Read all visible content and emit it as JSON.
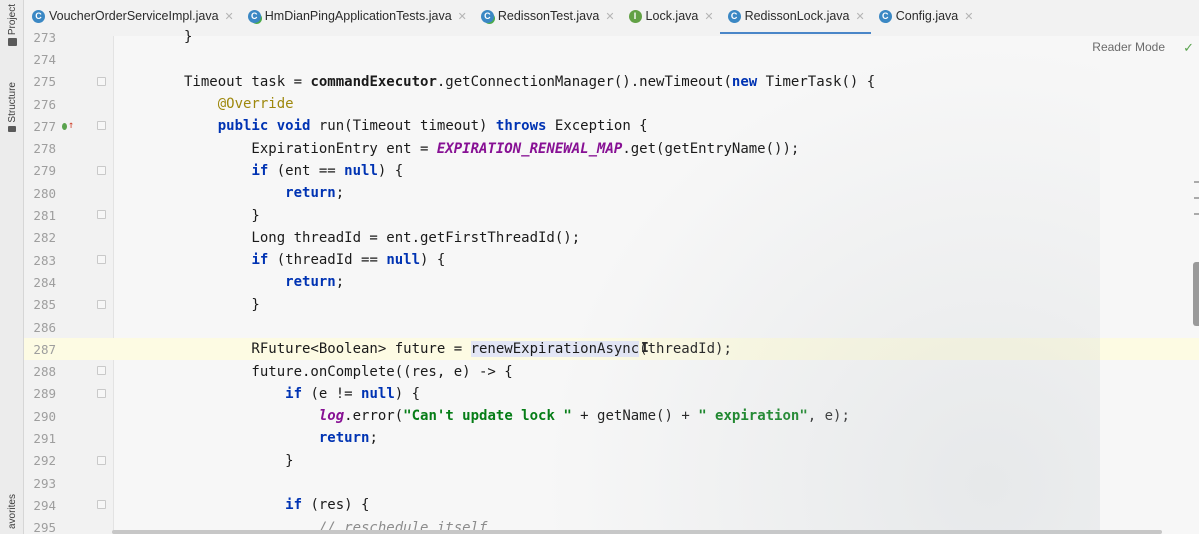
{
  "left_strip": {
    "project_label": "Project",
    "structure_label": "Structure",
    "favorites_label": "avorites"
  },
  "tabs": [
    {
      "name": "VoucherOrderServiceImpl.java",
      "icon": "class-icon",
      "active": false
    },
    {
      "name": "HmDianPingApplicationTests.java",
      "icon": "test-class-icon",
      "active": false
    },
    {
      "name": "RedissonTest.java",
      "icon": "test-class-icon",
      "active": false
    },
    {
      "name": "Lock.java",
      "icon": "interface-icon",
      "active": false
    },
    {
      "name": "RedissonLock.java",
      "icon": "class-icon",
      "active": true
    },
    {
      "name": "Config.java",
      "icon": "class-icon",
      "active": false
    }
  ],
  "tab_close_glyph": "✕",
  "reader_mode_label": "Reader Mode",
  "check_glyph": "✓",
  "colors": {
    "keyword": "#0033b3",
    "method": "#00627a",
    "static_field": "#871094",
    "string": "#067d17",
    "annotation": "#9e880d",
    "current_line": "#fdfbe3",
    "active_tab_underline": "#4a86c8"
  },
  "code": {
    "lines": [
      {
        "number": "273",
        "tokens": [
          {
            "t": "}",
            "c": ""
          }
        ]
      },
      {
        "number": "274",
        "tokens": []
      },
      {
        "number": "275",
        "tokens": [
          {
            "t": "Timeout task = ",
            "c": ""
          },
          {
            "t": "commandExecutor",
            "c": "boldname"
          },
          {
            "t": ".getConnectionManager().newTimeout(",
            "c": ""
          },
          {
            "t": "new",
            "c": "kw"
          },
          {
            "t": " TimerTask() {",
            "c": ""
          }
        ]
      },
      {
        "number": "276",
        "tokens": [
          {
            "t": "    @Override",
            "c": "anno"
          }
        ]
      },
      {
        "number": "277",
        "gutter_icon": "override-up-icon",
        "tokens": [
          {
            "t": "    ",
            "c": ""
          },
          {
            "t": "public",
            "c": "kw"
          },
          {
            "t": " ",
            "c": ""
          },
          {
            "t": "void",
            "c": "kw"
          },
          {
            "t": " run(Timeout timeout) ",
            "c": ""
          },
          {
            "t": "throws",
            "c": "kw"
          },
          {
            "t": " Exception {",
            "c": ""
          }
        ]
      },
      {
        "number": "278",
        "tokens": [
          {
            "t": "        ExpirationEntry ent = ",
            "c": ""
          },
          {
            "t": "EXPIRATION_RENEWAL_MAP",
            "c": "italic-field"
          },
          {
            "t": ".get(getEntryName());",
            "c": ""
          }
        ]
      },
      {
        "number": "279",
        "tokens": [
          {
            "t": "        ",
            "c": ""
          },
          {
            "t": "if",
            "c": "kw"
          },
          {
            "t": " (ent == ",
            "c": ""
          },
          {
            "t": "null",
            "c": "kw"
          },
          {
            "t": ") {",
            "c": ""
          }
        ]
      },
      {
        "number": "280",
        "tokens": [
          {
            "t": "            ",
            "c": ""
          },
          {
            "t": "return",
            "c": "kw"
          },
          {
            "t": ";",
            "c": ""
          }
        ]
      },
      {
        "number": "281",
        "tokens": [
          {
            "t": "        }",
            "c": ""
          }
        ]
      },
      {
        "number": "282",
        "tokens": [
          {
            "t": "        Long threadId = ent.getFirstThreadId();",
            "c": ""
          }
        ]
      },
      {
        "number": "283",
        "tokens": [
          {
            "t": "        ",
            "c": ""
          },
          {
            "t": "if",
            "c": "kw"
          },
          {
            "t": " (threadId == ",
            "c": ""
          },
          {
            "t": "null",
            "c": "kw"
          },
          {
            "t": ") {",
            "c": ""
          }
        ]
      },
      {
        "number": "284",
        "tokens": [
          {
            "t": "            ",
            "c": ""
          },
          {
            "t": "return",
            "c": "kw"
          },
          {
            "t": ";",
            "c": ""
          }
        ]
      },
      {
        "number": "285",
        "tokens": [
          {
            "t": "        }",
            "c": ""
          }
        ]
      },
      {
        "number": "286",
        "tokens": []
      },
      {
        "number": "287",
        "current": true,
        "tokens": [
          {
            "t": "        RFuture<Boolean> future = ",
            "c": ""
          },
          {
            "t": "renewExpirationAsync",
            "c": "hl"
          },
          {
            "t": "(threadId);",
            "c": ""
          }
        ]
      },
      {
        "number": "288",
        "tokens": [
          {
            "t": "        future.onComplete((res, e) -> {",
            "c": ""
          }
        ]
      },
      {
        "number": "289",
        "tokens": [
          {
            "t": "            ",
            "c": ""
          },
          {
            "t": "if",
            "c": "kw"
          },
          {
            "t": " (e != ",
            "c": ""
          },
          {
            "t": "null",
            "c": "kw"
          },
          {
            "t": ") {",
            "c": ""
          }
        ]
      },
      {
        "number": "290",
        "tokens": [
          {
            "t": "                ",
            "c": ""
          },
          {
            "t": "log",
            "c": "static"
          },
          {
            "t": ".error(",
            "c": ""
          },
          {
            "t": "\"Can't update lock \"",
            "c": "str"
          },
          {
            "t": " + getName() + ",
            "c": ""
          },
          {
            "t": "\" expiration\"",
            "c": "str"
          },
          {
            "t": ", e);",
            "c": ""
          }
        ]
      },
      {
        "number": "291",
        "tokens": [
          {
            "t": "                ",
            "c": ""
          },
          {
            "t": "return",
            "c": "kw"
          },
          {
            "t": ";",
            "c": ""
          }
        ]
      },
      {
        "number": "292",
        "tokens": [
          {
            "t": "            }",
            "c": ""
          }
        ]
      },
      {
        "number": "293",
        "tokens": []
      },
      {
        "number": "294",
        "tokens": [
          {
            "t": "            ",
            "c": ""
          },
          {
            "t": "if",
            "c": "kw"
          },
          {
            "t": " (res) {",
            "c": ""
          }
        ]
      },
      {
        "number": "295",
        "tokens": [
          {
            "t": "                ",
            "c": ""
          },
          {
            "t": "// reschedule itself",
            "c": "comment"
          }
        ]
      }
    ],
    "fold_markers": [
      "275",
      "277",
      "279",
      "281",
      "283",
      "285",
      "288",
      "289",
      "292",
      "294"
    ]
  }
}
